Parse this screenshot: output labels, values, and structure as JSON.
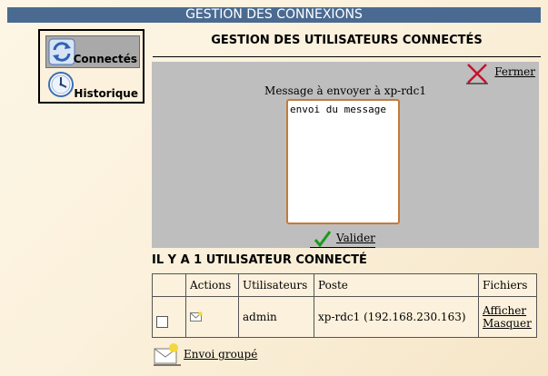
{
  "header": {
    "title": "GESTION DES CONNEXIONS"
  },
  "side_menu": {
    "items": [
      {
        "label": "Connectés",
        "icon": "refresh-icon",
        "active": true
      },
      {
        "label": "Historique",
        "icon": "clock-icon",
        "active": false
      }
    ]
  },
  "page": {
    "title": "GESTION DES UTILISATEURS CONNECTÉS"
  },
  "message_panel": {
    "close_label": "Fermer",
    "message_label": "Message à envoyer à xp-rdc1",
    "message_value": "envoi du message",
    "validate_label": "Valider"
  },
  "users": {
    "count_heading": "IL Y A 1 UTILISATEUR CONNECTÉ",
    "columns": [
      "Actions",
      "Utilisateurs",
      "Poste",
      "Fichiers"
    ],
    "rows": [
      {
        "user": "admin",
        "post": "xp-rdc1 (192.168.230.163)",
        "files_show": "Afficher",
        "files_hide": "Masquer"
      }
    ]
  },
  "group_send": {
    "label": "Envoi groupé"
  },
  "colors": {
    "header_bar": "#4a6a92",
    "panel_bg": "#bebebe",
    "textarea_border": "#c47a3a"
  }
}
